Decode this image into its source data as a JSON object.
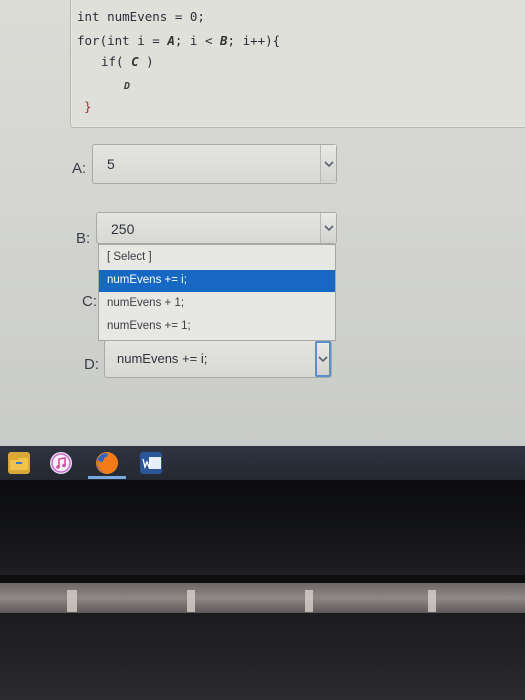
{
  "code": {
    "line1": "int numEvens = 0;",
    "line2_pre": "for(int i = ",
    "line2_a": "A",
    "line2_mid": "; i < ",
    "line2_b": "B",
    "line2_post": "; i++){",
    "line3_pre": "if( ",
    "line3_c": "C",
    "line3_post": " )",
    "line4_d": "D",
    "line5": "}"
  },
  "questions": {
    "a": {
      "label": "A:",
      "value": "5"
    },
    "b": {
      "label": "B:",
      "value": "250"
    },
    "c": {
      "label": "C:"
    },
    "d": {
      "label": "D:",
      "value": "numEvens += i;"
    }
  },
  "dropdown": {
    "options": [
      "[ Select ]",
      "numEvens += i;",
      "numEvens + 1;",
      "numEvens += 1;"
    ],
    "highlighted": "numEvens += i;"
  },
  "colors": {
    "highlight": "#1768c3",
    "focus_border": "#5a8fc9"
  },
  "taskbar": {
    "icons": [
      "file-explorer-icon",
      "itunes-icon",
      "firefox-icon",
      "word-icon"
    ]
  }
}
